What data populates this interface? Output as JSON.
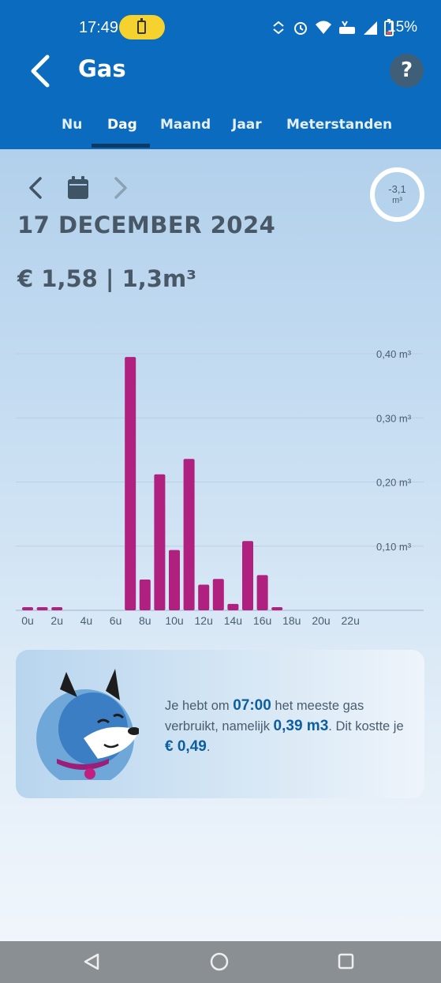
{
  "status": {
    "time": "17:49",
    "battery_percent": "15%",
    "icons": [
      "sync-icon",
      "alarm-icon",
      "wifi-icon",
      "volte-icon",
      "signal-icon",
      "battery-icon"
    ]
  },
  "header": {
    "title": "Gas",
    "help_label": "?"
  },
  "tabs": [
    {
      "label": "Nu"
    },
    {
      "label": "Dag"
    },
    {
      "label": "Maand"
    },
    {
      "label": "Jaar"
    },
    {
      "label": "Meterstanden"
    }
  ],
  "active_tab": "Dag",
  "period": {
    "date": "17 DECEMBER 2024",
    "delta_value": "-3,1",
    "delta_unit": "m³"
  },
  "summary": {
    "text": "€ 1,58 | 1,3m³"
  },
  "chart_data": {
    "type": "bar",
    "categories": [
      "0u",
      "1u",
      "2u",
      "3u",
      "4u",
      "5u",
      "6u",
      "7u",
      "8u",
      "9u",
      "10u",
      "11u",
      "12u",
      "13u",
      "14u",
      "15u",
      "16u",
      "17u",
      "18u",
      "19u",
      "20u",
      "21u",
      "22u",
      "23u"
    ],
    "values": [
      0.005,
      0.005,
      0.005,
      0,
      0,
      0,
      0,
      0.395,
      0.048,
      0.212,
      0.094,
      0.236,
      0.04,
      0.049,
      0.01,
      0.108,
      0.055,
      0.005,
      0,
      0,
      0,
      0,
      0,
      0
    ],
    "x_tick_labels": [
      "0u",
      "2u",
      "4u",
      "6u",
      "8u",
      "10u",
      "12u",
      "14u",
      "16u",
      "18u",
      "20u",
      "22u"
    ],
    "y_ticks": [
      0.1,
      0.2,
      0.3,
      0.4
    ],
    "y_tick_labels": [
      "0,10 m³",
      "0,20 m³",
      "0,30 m³",
      "0,40 m³"
    ],
    "ylim": [
      0,
      0.4
    ],
    "grid": true,
    "bar_color": "#b0207f",
    "title": "",
    "xlabel": "",
    "ylabel": ""
  },
  "info": {
    "t1": "Je hebt om ",
    "hour": "07:00",
    "t2": " het meeste gas verbruikt, namelijk ",
    "amount": "0,39 m3",
    "t3": ". Dit kostte je ",
    "cost": "€ 0,49",
    "t4": "."
  },
  "colors": {
    "brand_blue": "#0a6bbf",
    "bar_magenta": "#b0207f",
    "text_grey": "#495867",
    "accent_text": "#0d5e9e"
  }
}
